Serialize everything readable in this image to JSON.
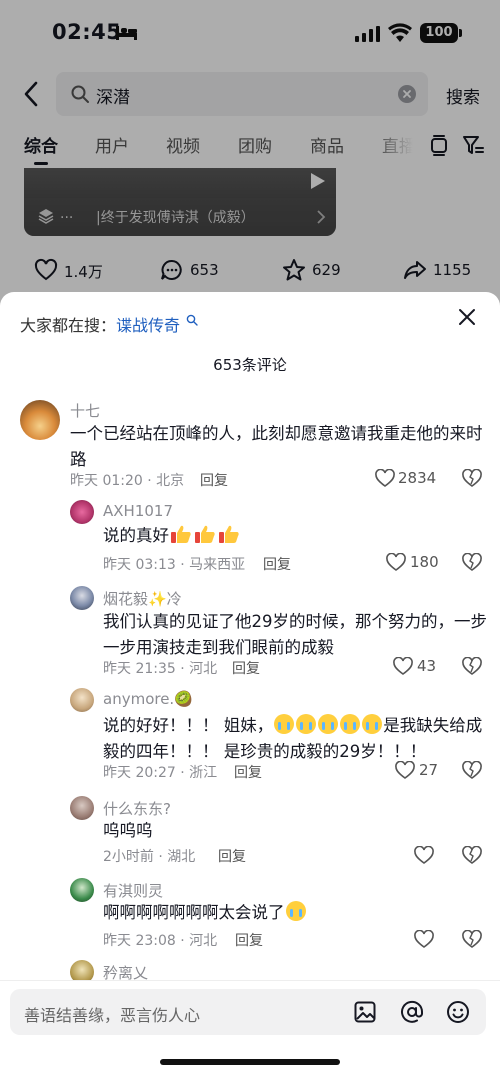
{
  "status": {
    "time": "02:45",
    "battery": "100"
  },
  "search": {
    "query": "深潜",
    "button": "搜索"
  },
  "tabs": [
    "综合",
    "用户",
    "视频",
    "团购",
    "商品",
    "直播"
  ],
  "video": {
    "dots": "...",
    "title": "|终于发现傅诗淇（成毅）"
  },
  "actions": {
    "likes": "1.4万",
    "comments": "653",
    "favorites": "629",
    "shares": "1155"
  },
  "sheet": {
    "trending_prefix": "大家都在搜：",
    "trending_term": "谍战传奇",
    "count_label": "653条评论",
    "input_placeholder": "善语结善缘，恶言伤人心"
  },
  "comments": [
    {
      "name": "十七",
      "text": "一个已经站在顶峰的人，此刻却愿意邀请我重走他的来时路",
      "meta": "昨天 01:20 · 北京",
      "reply": "回复",
      "likes": "2834"
    },
    {
      "name": "AXH1017",
      "text": "说的真好",
      "meta": "昨天 03:13 · 马来西亚",
      "reply": "回复",
      "likes": "180"
    },
    {
      "name": "烟花毅✨冷",
      "text": "我们认真的见证了他29岁的时候，那个努力的，一步一步用演技走到我们眼前的成毅",
      "meta": "昨天 21:35 · 河北",
      "reply": "回复",
      "likes": "43"
    },
    {
      "name": "anymore.🥝",
      "text_a": "说的好好！！！ 姐妹，",
      "text_b": "是我缺失给成毅的四年！！！ 是珍贵的成毅的29岁！！！",
      "meta": "昨天 20:27 · 浙江",
      "reply": "回复",
      "likes": "27"
    },
    {
      "name": "什么东东?",
      "text": "呜呜呜",
      "meta": "2小时前 · 湖北",
      "reply": "回复",
      "likes": ""
    },
    {
      "name": "有淇则灵",
      "text": "啊啊啊啊啊啊啊太会说了",
      "meta": "昨天 23:08 · 河北",
      "reply": "回复",
      "likes": ""
    },
    {
      "name": "矜离乂"
    }
  ]
}
